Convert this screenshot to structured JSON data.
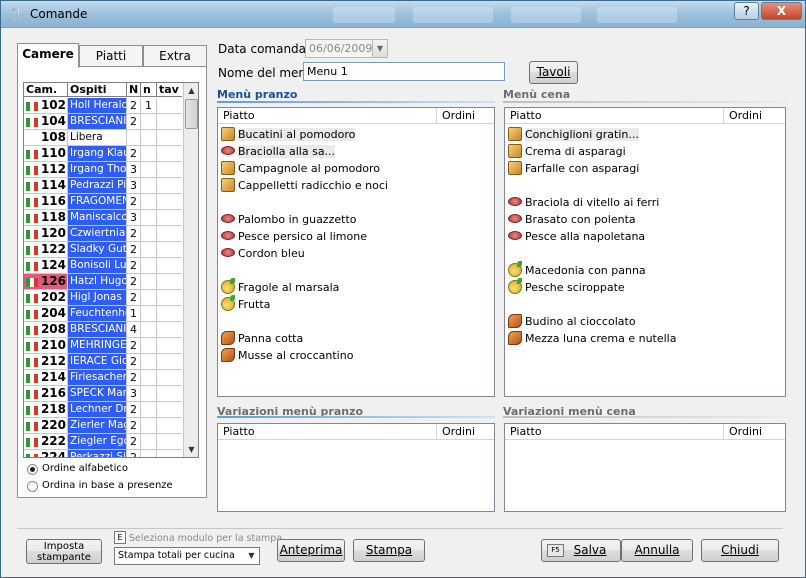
{
  "window": {
    "title": "Comande",
    "help": "?",
    "close": "X"
  },
  "tabs": [
    {
      "label": "Camere"
    },
    {
      "label": "Piatti"
    },
    {
      "label": "Extra"
    }
  ],
  "rooms_grid": {
    "columns": [
      "Cam.",
      "Ospiti",
      "N",
      "n",
      "tav"
    ],
    "rows": [
      {
        "room": "102",
        "guest": "Holl Herald",
        "N": "2",
        "n": "1",
        "tav": ""
      },
      {
        "room": "104",
        "guest": "BRESCIANI",
        "N": "2",
        "n": "",
        "tav": ""
      },
      {
        "room": "108",
        "guest": "Libera",
        "N": "",
        "n": "",
        "tav": ""
      },
      {
        "room": "110",
        "guest": "Irgang Klau",
        "N": "2",
        "n": "",
        "tav": ""
      },
      {
        "room": "112",
        "guest": "Irgang Thor",
        "N": "3",
        "n": "",
        "tav": ""
      },
      {
        "room": "114",
        "guest": "Pedrazzi Pie",
        "N": "3",
        "n": "",
        "tav": ""
      },
      {
        "room": "116",
        "guest": "FRAGOMEN",
        "N": "2",
        "n": "",
        "tav": ""
      },
      {
        "room": "118",
        "guest": "Maniscalco",
        "N": "3",
        "n": "",
        "tav": ""
      },
      {
        "room": "120",
        "guest": "Czwiertnia I",
        "N": "2",
        "n": "",
        "tav": ""
      },
      {
        "room": "122",
        "guest": "Sladky Gutt",
        "N": "2",
        "n": "",
        "tav": ""
      },
      {
        "room": "124",
        "guest": "Bonisoli Luc",
        "N": "2",
        "n": "",
        "tav": ""
      },
      {
        "room": "126",
        "guest": "Hatzl Hugo",
        "N": "2",
        "n": "",
        "tav": ""
      },
      {
        "room": "202",
        "guest": "Higl Jonas",
        "N": "2",
        "n": "",
        "tav": ""
      },
      {
        "room": "204",
        "guest": "Feuchtenho",
        "N": "1",
        "n": "",
        "tav": ""
      },
      {
        "room": "208",
        "guest": "BRESCIANI",
        "N": "4",
        "n": "",
        "tav": ""
      },
      {
        "room": "210",
        "guest": "MEHRINGER",
        "N": "2",
        "n": "",
        "tav": ""
      },
      {
        "room": "212",
        "guest": "IERACE Gio",
        "N": "2",
        "n": "",
        "tav": ""
      },
      {
        "room": "214",
        "guest": "Firiesacher",
        "N": "2",
        "n": "",
        "tav": ""
      },
      {
        "room": "216",
        "guest": "SPECK Mark",
        "N": "3",
        "n": "",
        "tav": ""
      },
      {
        "room": "218",
        "guest": "Lechner Dr.",
        "N": "2",
        "n": "",
        "tav": ""
      },
      {
        "room": "220",
        "guest": "Zierler Mag",
        "N": "2",
        "n": "",
        "tav": ""
      },
      {
        "room": "222",
        "guest": "Ziegler Egor",
        "N": "2",
        "n": "",
        "tav": ""
      },
      {
        "room": "224",
        "guest": "Perkazzi Sil",
        "N": "2",
        "n": "",
        "tav": ""
      }
    ]
  },
  "sort_options": [
    {
      "label": "Ordine alfabetico",
      "checked": true
    },
    {
      "label": "Ordina in base a presenze",
      "checked": false
    }
  ],
  "form": {
    "data_label": "Data comanda:",
    "data_value": "06/06/2009",
    "nome_label": "Nome del menù:",
    "nome_value": "Menu 1",
    "tavoli_button": "Tavoli"
  },
  "menu_pranzo": {
    "title": "Menù pranzo",
    "col_piatto": "Piatto",
    "col_ordini": "Ordini",
    "items": [
      {
        "name": "Bucatini al pomodoro",
        "icon": "pasta",
        "group": 0
      },
      {
        "name": "Braciolla alla sa...",
        "icon": "meat",
        "group": 0
      },
      {
        "name": "Campagnole al pomodoro",
        "icon": "pasta",
        "group": 0
      },
      {
        "name": "Cappelletti radicchio e noci",
        "icon": "pasta",
        "group": 0
      },
      {
        "name": "Palombo in guazzetto",
        "icon": "meat",
        "group": 1
      },
      {
        "name": "Pesce persico al limone",
        "icon": "meat",
        "group": 1
      },
      {
        "name": "Cordon bleu",
        "icon": "meat",
        "group": 1
      },
      {
        "name": "Fragole al marsala",
        "icon": "fruit",
        "group": 2
      },
      {
        "name": "Frutta",
        "icon": "fruit",
        "group": 2
      },
      {
        "name": "Panna cotta",
        "icon": "dessert",
        "group": 3
      },
      {
        "name": "Musse al croccantino",
        "icon": "dessert",
        "group": 3
      }
    ]
  },
  "menu_cena": {
    "title": "Menù cena",
    "col_piatto": "Piatto",
    "col_ordini": "Ordini",
    "items": [
      {
        "name": "Conchiglioni gratin...",
        "icon": "pasta",
        "group": 0
      },
      {
        "name": "Crema di asparagi",
        "icon": "pasta",
        "group": 0
      },
      {
        "name": "Farfalle con asparagi",
        "icon": "pasta",
        "group": 0
      },
      {
        "name": "Braciola di vitello ai ferri",
        "icon": "meat",
        "group": 1
      },
      {
        "name": "Brasato con polenta",
        "icon": "meat",
        "group": 1
      },
      {
        "name": "Pesce alla napoletana",
        "icon": "meat",
        "group": 1
      },
      {
        "name": "Macedonia con panna",
        "icon": "fruit",
        "group": 2
      },
      {
        "name": "Pesche sciroppate",
        "icon": "fruit",
        "group": 2
      },
      {
        "name": "Budino al cioccolato",
        "icon": "dessert",
        "group": 3
      },
      {
        "name": "Mezza luna crema e nutella",
        "icon": "dessert",
        "group": 3
      }
    ]
  },
  "variazioni_pranzo": {
    "title": "Variazioni menù pranzo",
    "col_piatto": "Piatto",
    "col_ordini": "Ordini"
  },
  "variazioni_cena": {
    "title": "Variazioni menù cena",
    "col_piatto": "Piatto",
    "col_ordini": "Ordini"
  },
  "bottom": {
    "imposta_line1": "Imposta",
    "imposta_line2": "stampante",
    "modulo_hint": "Seleziona modulo per la stampa",
    "modulo_value": "Stampa totali per cucina",
    "anteprima": "Anteprima",
    "stampa": "Stampa",
    "f5": "F5",
    "salva": "Salva",
    "annulla": "Annulla",
    "chiudi": "Chiudi"
  },
  "colors": {
    "guest_bg": "#2f5df2",
    "section_title": "#1a4fa0",
    "selected_room": "#e05a7a"
  }
}
